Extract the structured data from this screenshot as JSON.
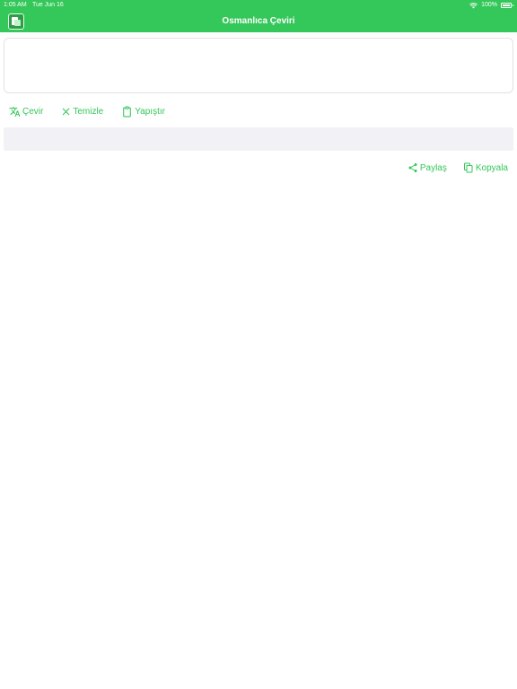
{
  "status_bar": {
    "time": "1:05 AM",
    "date": "Tue Jun 16",
    "battery": "100%"
  },
  "nav": {
    "title": "Osmanlıca Çeviri"
  },
  "input": {
    "value": "",
    "placeholder": ""
  },
  "actions": {
    "translate_label": "Çevir",
    "clear_label": "Temizle",
    "paste_label": "Yapıştır"
  },
  "result": {
    "value": ""
  },
  "result_actions": {
    "share_label": "Paylaş",
    "copy_label": "Kopyala"
  },
  "colors": {
    "accent": "#34c759",
    "result_bg": "#f2f2f6"
  },
  "icons": {
    "translate": "translate-icon",
    "clear": "close-icon",
    "paste": "clipboard-icon",
    "share": "share-icon",
    "copy": "copy-icon"
  }
}
